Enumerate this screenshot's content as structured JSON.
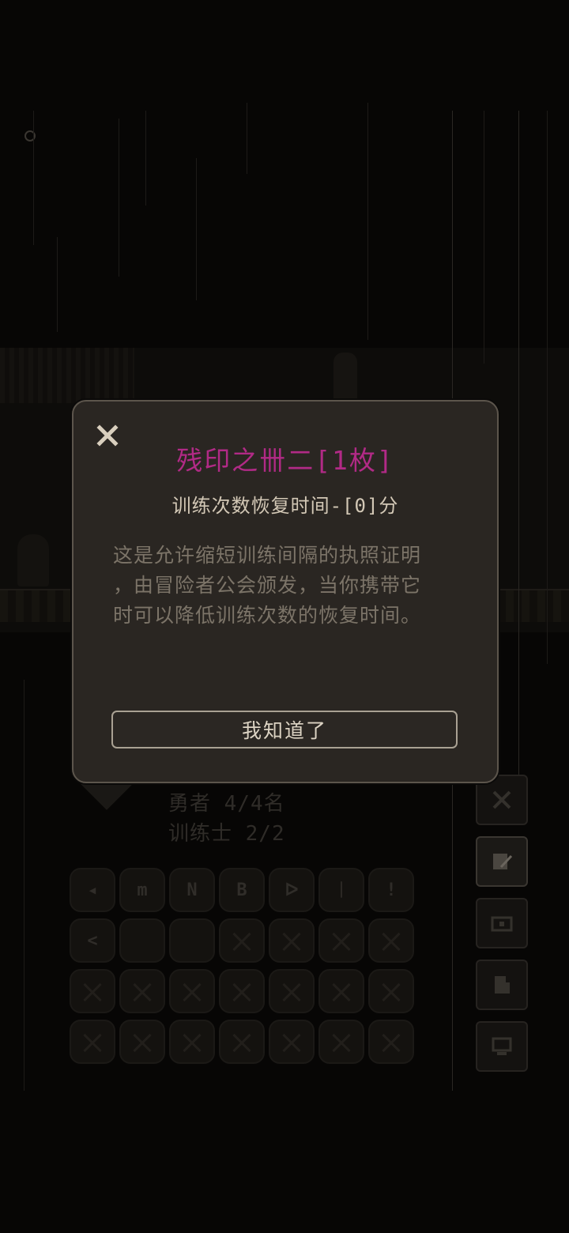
{
  "colors": {
    "title": "#b12a86",
    "subtitle": "#d3c8b6",
    "description": "#7c7468",
    "dialog_bg": "#2a2622",
    "dialog_border": "#5c554c",
    "button_border": "#a9a193"
  },
  "dialog": {
    "close_icon": "close-icon",
    "title": "残印之卌二[1枚]",
    "subtitle": "训练次数恢复时间-[0]分",
    "description_lines": [
      "这是允许缩短训练间隔的执照证明",
      "，由冒险者公会颁发，当你携带它",
      "时可以降低训练次数的恢复时间。"
    ],
    "confirm_label": "我知道了"
  },
  "base_panel": {
    "heroes": "勇者 4/4名",
    "trainers": "训练士 2/2",
    "skill_glyphs": [
      "◂",
      "m",
      "N",
      "B",
      "ᐅ",
      "ᛁ",
      "!",
      "<"
    ],
    "side_buttons": [
      {
        "icon": "crossed-swords-icon"
      },
      {
        "icon": "scroll-quill-icon",
        "active": true
      },
      {
        "icon": "treasure-chest-icon"
      },
      {
        "icon": "document-stack-icon"
      },
      {
        "icon": "computer-monitor-icon"
      }
    ]
  }
}
